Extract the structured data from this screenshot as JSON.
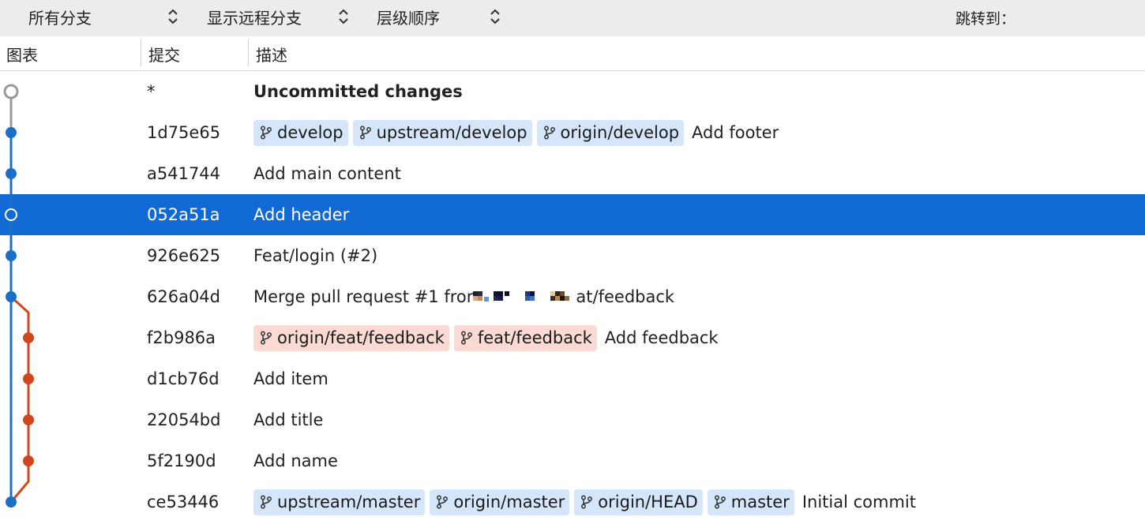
{
  "toolbar": {
    "branch_filter": "所有分支",
    "remote_filter": "显示远程分支",
    "order": "层级顺序",
    "jump_label": "跳转到："
  },
  "columns": {
    "graph": "图表",
    "commit": "提交",
    "description": "描述"
  },
  "colors": {
    "main_branch": "#1c6fc6",
    "feature_branch": "#d0461d",
    "uncommitted_node": "#999999",
    "selected_row": "#1169d3",
    "ref_blue_bg": "#d5e6fa",
    "ref_orange_bg": "#fbdad3"
  },
  "commits": [
    {
      "hash": "*",
      "refs": [],
      "message": "Uncommitted changes"
    },
    {
      "hash": "1d75e65",
      "refs": [
        {
          "name": "develop"
        },
        {
          "name": "upstream/develop"
        },
        {
          "name": "origin/develop"
        }
      ],
      "message": "Add footer"
    },
    {
      "hash": "a541744",
      "refs": [],
      "message": "Add main content"
    },
    {
      "hash": "052a51a",
      "refs": [],
      "message": "Add header"
    },
    {
      "hash": "926e625",
      "refs": [],
      "message": "Feat/login (#2)"
    },
    {
      "hash": "626a04d",
      "refs": [],
      "message": "Merge pull request #1 fror",
      "message_suffix": "at/feedback"
    },
    {
      "hash": "f2b986a",
      "refs": [
        {
          "name": "origin/feat/feedback"
        },
        {
          "name": "feat/feedback"
        }
      ],
      "message": "Add feedback"
    },
    {
      "hash": "d1cb76d",
      "refs": [],
      "message": "Add item"
    },
    {
      "hash": "22054bd",
      "refs": [],
      "message": "Add title"
    },
    {
      "hash": "5f2190d",
      "refs": [],
      "message": "Add name"
    },
    {
      "hash": "ce53446",
      "refs": [
        {
          "name": "upstream/master"
        },
        {
          "name": "origin/master"
        },
        {
          "name": "origin/HEAD"
        },
        {
          "name": "master"
        }
      ],
      "message": "Initial commit"
    }
  ],
  "icons": {
    "chevron": "up-down-chevron-icon",
    "branch": "branch-icon"
  }
}
